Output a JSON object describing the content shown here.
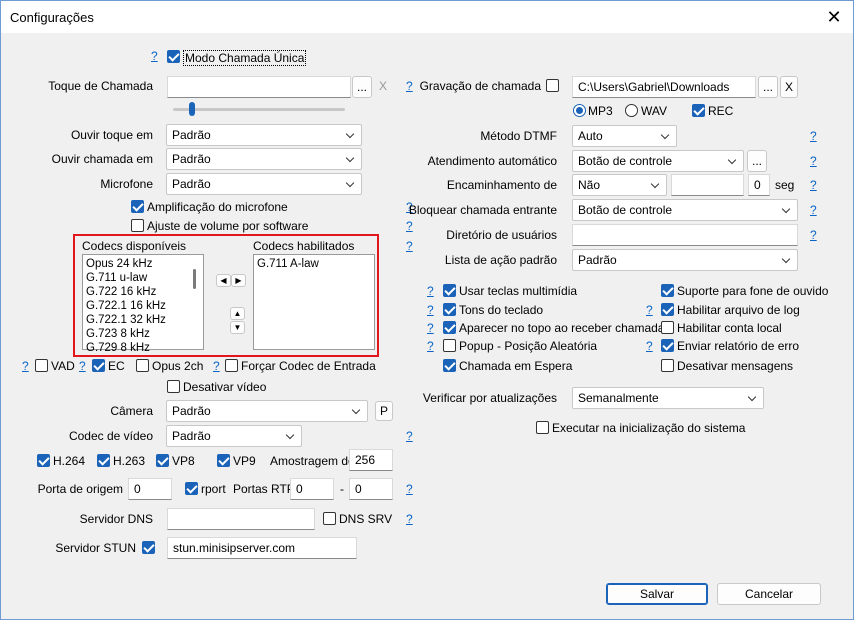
{
  "window": {
    "title": "Configurações",
    "close": "✕"
  },
  "help": "?",
  "modo_chamada_unica": {
    "label": "Modo Chamada Única",
    "checked": true
  },
  "toque": {
    "label": "Toque de Chamada",
    "value": "",
    "browse": "...",
    "clear": "X",
    "volume": 0.08
  },
  "gravacao": {
    "label": "Gravação de chamada",
    "checked": false,
    "path": "C:\\Users\\Gabriel\\Downloads",
    "browse": "...",
    "clear": "X",
    "mp3": "MP3",
    "wav": "WAV",
    "rec": "REC",
    "format_selected": "MP3",
    "rec_checked": true
  },
  "ouvir_toque": {
    "label": "Ouvir toque em",
    "value": "Padrão"
  },
  "ouvir_chamada": {
    "label": "Ouvir chamada em",
    "value": "Padrão"
  },
  "microfone": {
    "label": "Microfone",
    "value": "Padrão"
  },
  "metodo_dtmf": {
    "label": "Método DTMF",
    "value": "Auto"
  },
  "atendimento": {
    "label": "Atendimento automático",
    "value": "Botão de controle",
    "more": "..."
  },
  "encaminhamento": {
    "label": "Encaminhamento de",
    "value": "Não",
    "target": "",
    "seconds": "0",
    "unit": "seg"
  },
  "bloquear": {
    "label": "Bloquear chamada entrante",
    "value": "Botão de controle"
  },
  "diretorio": {
    "label": "Diretório de usuários",
    "value": ""
  },
  "lista_acao": {
    "label": "Lista de ação padrão",
    "value": "Padrão"
  },
  "amplificacao": {
    "label": "Amplificação do microfone",
    "checked": true
  },
  "ajuste_volume": {
    "label": "Ajuste de volume por software",
    "checked": false
  },
  "codecs": {
    "available_label": "Codecs disponíveis",
    "enabled_label": "Codecs habilitados",
    "available": [
      "Opus 24 kHz",
      "G.711 u-law",
      "G.722 16 kHz",
      "G.722.1 16 kHz",
      "G.722.1 32 kHz",
      "G.723 8 kHz",
      "G.729 8 kHz"
    ],
    "enabled": [
      "G.711 A-law"
    ]
  },
  "vad": {
    "label": "VAD",
    "checked": false
  },
  "ec": {
    "label": "EC",
    "checked": true
  },
  "opus2ch": {
    "label": "Opus 2ch",
    "checked": false
  },
  "forcar_codec": {
    "label": "Forçar Codec de Entrada",
    "checked": false
  },
  "desativar_video": {
    "label": "Desativar vídeo",
    "checked": false
  },
  "camera": {
    "label": "Câmera",
    "value": "Padrão",
    "p": "P"
  },
  "codec_video": {
    "label": "Codec de vídeo",
    "value": "Padrão"
  },
  "video_codecs": [
    {
      "label": "H.264",
      "checked": true
    },
    {
      "label": "H.263",
      "checked": true
    },
    {
      "label": "VP8",
      "checked": true
    },
    {
      "label": "VP9",
      "checked": true
    }
  ],
  "amostragem": {
    "label": "Amostragem do",
    "value": "256"
  },
  "porta_origem": {
    "label": "Porta de origem",
    "value": "0"
  },
  "rport": {
    "label": "rport",
    "checked": true
  },
  "portas_rtp": {
    "label": "Portas RTP",
    "from": "0",
    "sep": "-",
    "to": "0"
  },
  "servidor_dns": {
    "label": "Servidor DNS",
    "value": ""
  },
  "dns_srv": {
    "label": "DNS SRV",
    "checked": false
  },
  "servidor_stun": {
    "label": "Servidor STUN",
    "checked": true,
    "value": "stun.minisipserver.com"
  },
  "right_checks": [
    {
      "label": "Usar teclas multimídia",
      "checked": true,
      "help": true
    },
    {
      "label": "Tons do teclado",
      "checked": true,
      "help": true
    },
    {
      "label": "Aparecer no topo ao receber chamada",
      "checked": true,
      "help": true
    },
    {
      "label": "Popup - Posição Aleatória",
      "checked": false,
      "help": true
    },
    {
      "label": "Chamada em Espera",
      "checked": true,
      "help": false
    }
  ],
  "right_checks2": [
    {
      "label": "Suporte para fone de ouvido",
      "checked": true,
      "help": false
    },
    {
      "label": "Habilitar arquivo de log",
      "checked": true,
      "help": true
    },
    {
      "label": "Habilitar conta local",
      "checked": false,
      "help": false
    },
    {
      "label": "Enviar relatório de erro",
      "checked": true,
      "help": true
    },
    {
      "label": "Desativar mensagens",
      "checked": false,
      "help": false
    }
  ],
  "verificar": {
    "label": "Verificar por atualizações",
    "value": "Semanalmente"
  },
  "executar": {
    "label": "Executar na inicialização do sistema",
    "checked": false
  },
  "buttons": {
    "save": "Salvar",
    "cancel": "Cancelar"
  }
}
